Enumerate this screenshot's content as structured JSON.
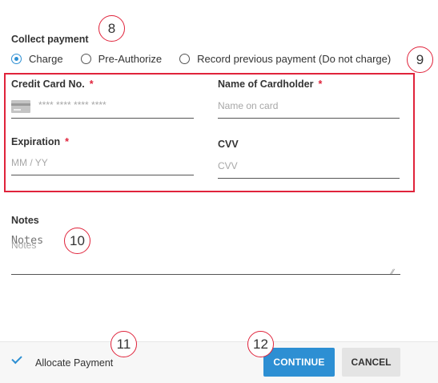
{
  "collect_payment": {
    "title": "Collect payment",
    "options": [
      {
        "label": "Charge",
        "selected": true
      },
      {
        "label": "Pre-Authorize",
        "selected": false
      },
      {
        "label": "Record previous payment (Do not charge)",
        "selected": false
      }
    ]
  },
  "card_form": {
    "card_number": {
      "label": "Credit Card No.",
      "required_mark": "*",
      "placeholder": "**** **** **** ****",
      "icon": "credit-card-icon"
    },
    "cardholder": {
      "label": "Name of Cardholder",
      "required_mark": "*",
      "placeholder": "Name on card"
    },
    "expiration": {
      "label": "Expiration",
      "required_mark": "*",
      "placeholder": "MM / YY"
    },
    "cvv": {
      "label": "CVV",
      "placeholder": "CVV"
    }
  },
  "notes": {
    "label": "Notes",
    "placeholder": "Notes"
  },
  "footer": {
    "allocate_label": "Allocate Payment",
    "continue_label": "CONTINUE",
    "cancel_label": "CANCEL"
  },
  "callouts": [
    "8",
    "9",
    "10",
    "11",
    "12"
  ],
  "colors": {
    "accent": "#2d8fd3",
    "required": "#e0233b",
    "highlight_border": "#e0233b"
  }
}
